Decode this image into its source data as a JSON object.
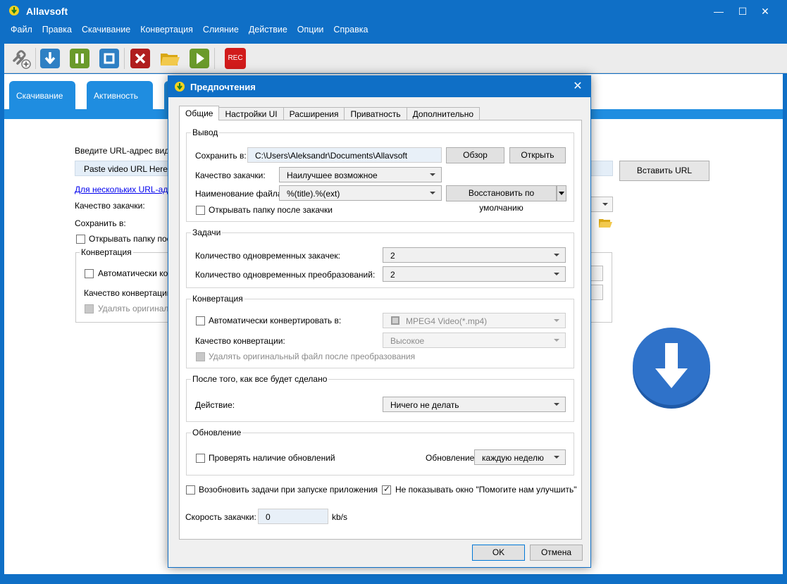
{
  "app": {
    "title": "Allavsoft",
    "menu": [
      "Файл",
      "Правка",
      "Скачивание",
      "Конвертация",
      "Слияние",
      "Действие",
      "Опции",
      "Справка"
    ],
    "toolbar": {
      "rec_label": "REC",
      "icons": [
        "add-url-icon",
        "download-icon",
        "pause-icon",
        "stop-icon",
        "delete-icon",
        "open-folder-icon",
        "play-icon",
        "record-icon"
      ]
    },
    "colors": {
      "accent": "#0f6fc6",
      "tab_blue": "#1f8de0"
    }
  },
  "main": {
    "tabs": [
      "Скачивание",
      "Активность"
    ],
    "url_prompt": "Введите URL-адрес видео",
    "url_placeholder": "Paste video URL Here",
    "paste_button": "Вставить URL",
    "multi_url_link": "Для нескольких URL-адре",
    "quality_label": "Качество закачки:",
    "save_to_label": "Сохранить в:",
    "open_folder_label": "Открывать папку посл",
    "conversion_group": "Конвертация",
    "auto_convert_label": "Автоматически конв",
    "conversion_quality_label": "Качество конвертации:",
    "delete_original_label": "Удалять оригинал"
  },
  "dialog": {
    "title": "Предпочтения",
    "tabs": [
      "Общие",
      "Настройки UI",
      "Расширения",
      "Приватность",
      "Дополнительно"
    ],
    "output": {
      "group_title": "Вывод",
      "save_label": "Сохранить в:",
      "save_path": "C:\\Users\\Aleksandr\\Documents\\Allavsoft",
      "browse_button": "Обзор",
      "open_button": "Открыть",
      "quality_label": "Качество закачки:",
      "quality_value": "Наилучшее возможное",
      "naming_label": "Наименование файла:",
      "naming_value": "%(title).%(ext)",
      "restore_button": "Восстановить по умолчанию",
      "open_after_label": "Открывать папку после закачки"
    },
    "tasks": {
      "group_title": "Задачи",
      "concurrent_downloads_label": "Количество одновременных закачек:",
      "concurrent_downloads_value": "2",
      "concurrent_conversions_label": "Количество одновременных преобразований:",
      "concurrent_conversions_value": "2"
    },
    "conversion": {
      "group_title": "Конвертация",
      "auto_convert_label": "Автоматически конвертировать в:",
      "auto_convert_value": "MPEG4 Video(*.mp4)",
      "quality_label": "Качество конвертации:",
      "quality_value": "Высокое",
      "delete_original_label": "Удалять оригинальный файл после преобразования"
    },
    "after_done": {
      "group_title": "После того, как все будет сделано",
      "action_label": "Действие:",
      "action_value": "Ничего не делать"
    },
    "update": {
      "group_title": "Обновление",
      "check_label": "Проверять наличие обновлений",
      "frequency_label": "Обновление",
      "frequency_value": "каждую неделю"
    },
    "resume_label": "Возобновить задачи при запуске приложения",
    "no_help_label": "Не показывать окно \"Помогите нам улучшить\"",
    "no_help_checked": true,
    "speed_label": "Скорость закачки:",
    "speed_value": "0",
    "speed_unit": "kb/s",
    "ok_button": "OK",
    "cancel_button": "Отмена"
  }
}
